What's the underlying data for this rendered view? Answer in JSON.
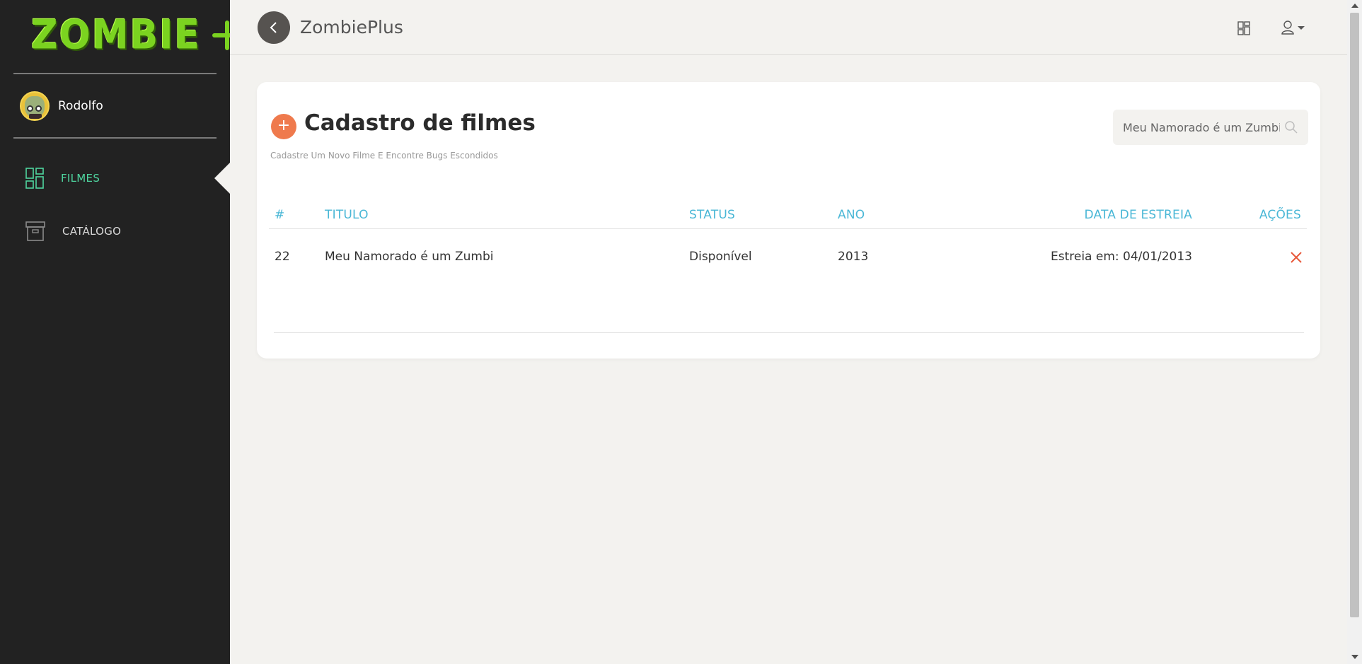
{
  "sidebar": {
    "logo_text": "ZOMBIE",
    "user_name": "Rodolfo",
    "items": [
      {
        "label": "FILMES",
        "icon": "dashboard-grid-icon",
        "active": true
      },
      {
        "label": "CATÁLOGO",
        "icon": "archive-box-icon",
        "active": false
      }
    ]
  },
  "header": {
    "title": "ZombiePlus"
  },
  "card": {
    "title": "Cadastro de filmes",
    "subtitle": "Cadastre Um Novo Filme E Encontre Bugs Escondidos",
    "search_value": "Meu Namorado é um Zumbi"
  },
  "table": {
    "columns": [
      "#",
      "TITULO",
      "STATUS",
      "ANO",
      "DATA DE ESTREIA",
      "AÇÕES"
    ],
    "rows": [
      {
        "id": "22",
        "title": "Meu Namorado é um Zumbi",
        "status": "Disponível",
        "year": "2013",
        "release": "Estreia em: 04/01/2013"
      }
    ]
  },
  "colors": {
    "sidebar_bg": "#222222",
    "accent_green": "#4fd6a0",
    "header_teal": "#4ab7d6",
    "add_orange": "#ef7a4d",
    "delete_red": "#e85a3c"
  }
}
